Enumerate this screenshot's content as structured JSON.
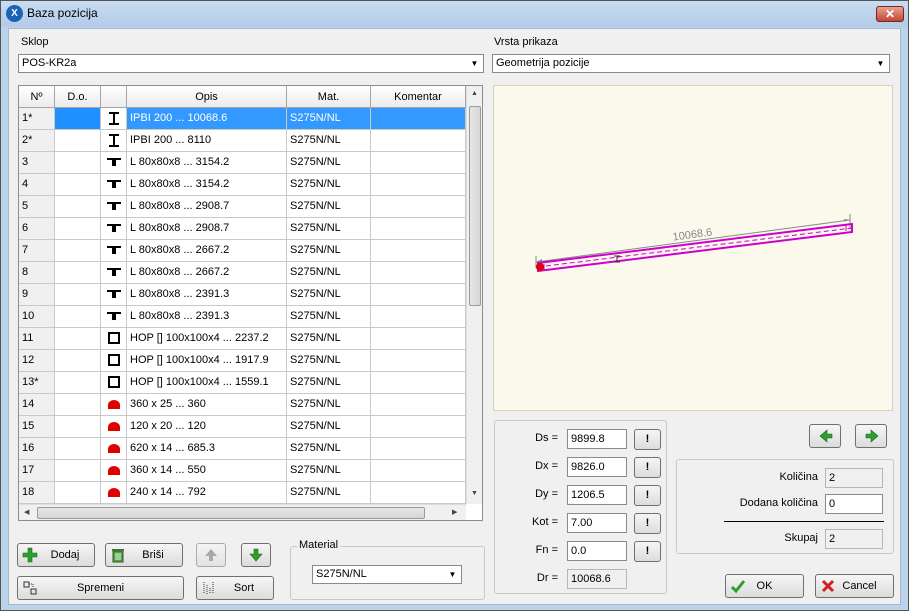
{
  "window": {
    "title": "Baza pozicija",
    "close_label": "✕"
  },
  "sklop": {
    "label": "Sklop",
    "value": "POS-KR2a"
  },
  "vrsta": {
    "label": "Vrsta prikaza",
    "value": "Geometrija pozicije"
  },
  "table": {
    "headers": [
      "Nº",
      "D.o.",
      "",
      "Opis",
      "Mat.",
      "Komentar"
    ],
    "rows": [
      {
        "no": "1*",
        "icon": "i-beam",
        "opis": "IPBI 200 ... 10068.6",
        "mat": "S275N/NL",
        "kom": ""
      },
      {
        "no": "2*",
        "icon": "i-beam",
        "opis": "IPBI 200 ... 8110",
        "mat": "S275N/NL",
        "kom": ""
      },
      {
        "no": "3",
        "icon": "double-angle",
        "opis": "L 80x80x8 ... 3154.2",
        "mat": "S275N/NL",
        "kom": ""
      },
      {
        "no": "4",
        "icon": "double-angle",
        "opis": "L 80x80x8 ... 3154.2",
        "mat": "S275N/NL",
        "kom": ""
      },
      {
        "no": "5",
        "icon": "double-angle",
        "opis": "L 80x80x8 ... 2908.7",
        "mat": "S275N/NL",
        "kom": ""
      },
      {
        "no": "6",
        "icon": "double-angle",
        "opis": "L 80x80x8 ... 2908.7",
        "mat": "S275N/NL",
        "kom": ""
      },
      {
        "no": "7",
        "icon": "double-angle",
        "opis": "L 80x80x8 ... 2667.2",
        "mat": "S275N/NL",
        "kom": ""
      },
      {
        "no": "8",
        "icon": "double-angle",
        "opis": "L 80x80x8 ... 2667.2",
        "mat": "S275N/NL",
        "kom": ""
      },
      {
        "no": "9",
        "icon": "double-angle",
        "opis": "L 80x80x8 ... 2391.3",
        "mat": "S275N/NL",
        "kom": ""
      },
      {
        "no": "10",
        "icon": "double-angle",
        "opis": "L 80x80x8 ... 2391.3",
        "mat": "S275N/NL",
        "kom": ""
      },
      {
        "no": "11",
        "icon": "hollow-square",
        "opis": "HOP [] 100x100x4 ... 2237.2",
        "mat": "S275N/NL",
        "kom": ""
      },
      {
        "no": "12",
        "icon": "hollow-square",
        "opis": "HOP [] 100x100x4 ... 1917.9",
        "mat": "S275N/NL",
        "kom": ""
      },
      {
        "no": "13*",
        "icon": "hollow-square",
        "opis": "HOP [] 100x100x4 ... 1559.1",
        "mat": "S275N/NL",
        "kom": ""
      },
      {
        "no": "14",
        "icon": "plate",
        "opis": "360 x 25 ... 360",
        "mat": "S275N/NL",
        "kom": ""
      },
      {
        "no": "15",
        "icon": "plate",
        "opis": "120 x 20 ... 120",
        "mat": "S275N/NL",
        "kom": ""
      },
      {
        "no": "16",
        "icon": "plate",
        "opis": "620 x 14 ... 685.3",
        "mat": "S275N/NL",
        "kom": ""
      },
      {
        "no": "17",
        "icon": "plate",
        "opis": "360 x 14 ... 550",
        "mat": "S275N/NL",
        "kom": ""
      },
      {
        "no": "18",
        "icon": "plate",
        "opis": "240 x 14 ... 792",
        "mat": "S275N/NL",
        "kom": ""
      }
    ]
  },
  "buttons": {
    "dodaj": "Dodaj",
    "brisi": "Briši",
    "spremeni": "Spremeni",
    "sort": "Sort",
    "ok": "OK",
    "cancel": "Cancel"
  },
  "material": {
    "group_label": "Material",
    "value": "S275N/NL"
  },
  "preview": {
    "dimension_label": "10068.6"
  },
  "geometry": {
    "ds": {
      "label": "Ds =",
      "value": "9899.8"
    },
    "dx": {
      "label": "Dx =",
      "value": "9826.0"
    },
    "dy": {
      "label": "Dy =",
      "value": "1206.5"
    },
    "kot": {
      "label": "Kot =",
      "value": "7.00"
    },
    "fn": {
      "label": "Fn =",
      "value": "0.0"
    },
    "dr": {
      "label": "Dr =",
      "value": "10068.6"
    },
    "bang_label": "!"
  },
  "quantity": {
    "kolicina_label": "Količina",
    "kolicina": "2",
    "dodana_label": "Dodana količina",
    "dodana": "0",
    "skupaj_label": "Skupaj",
    "skupaj": "2"
  },
  "colors": {
    "selection": "#3399ff",
    "beam": "#cc00cc",
    "green": "#2e9e2e",
    "red_dot": "#e00000"
  }
}
